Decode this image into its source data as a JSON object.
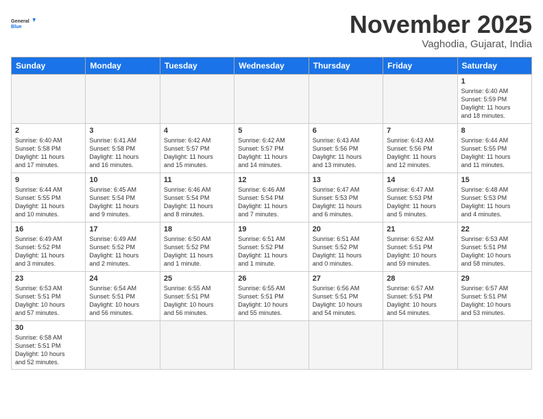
{
  "logo": {
    "general": "General",
    "blue": "Blue"
  },
  "header": {
    "title": "November 2025",
    "subtitle": "Vaghodia, Gujarat, India"
  },
  "weekdays": [
    "Sunday",
    "Monday",
    "Tuesday",
    "Wednesday",
    "Thursday",
    "Friday",
    "Saturday"
  ],
  "weeks": [
    [
      {
        "day": "",
        "info": ""
      },
      {
        "day": "",
        "info": ""
      },
      {
        "day": "",
        "info": ""
      },
      {
        "day": "",
        "info": ""
      },
      {
        "day": "",
        "info": ""
      },
      {
        "day": "",
        "info": ""
      },
      {
        "day": "1",
        "info": "Sunrise: 6:40 AM\nSunset: 5:59 PM\nDaylight: 11 hours\nand 18 minutes."
      }
    ],
    [
      {
        "day": "2",
        "info": "Sunrise: 6:40 AM\nSunset: 5:58 PM\nDaylight: 11 hours\nand 17 minutes."
      },
      {
        "day": "3",
        "info": "Sunrise: 6:41 AM\nSunset: 5:58 PM\nDaylight: 11 hours\nand 16 minutes."
      },
      {
        "day": "4",
        "info": "Sunrise: 6:42 AM\nSunset: 5:57 PM\nDaylight: 11 hours\nand 15 minutes."
      },
      {
        "day": "5",
        "info": "Sunrise: 6:42 AM\nSunset: 5:57 PM\nDaylight: 11 hours\nand 14 minutes."
      },
      {
        "day": "6",
        "info": "Sunrise: 6:43 AM\nSunset: 5:56 PM\nDaylight: 11 hours\nand 13 minutes."
      },
      {
        "day": "7",
        "info": "Sunrise: 6:43 AM\nSunset: 5:56 PM\nDaylight: 11 hours\nand 12 minutes."
      },
      {
        "day": "8",
        "info": "Sunrise: 6:44 AM\nSunset: 5:55 PM\nDaylight: 11 hours\nand 11 minutes."
      }
    ],
    [
      {
        "day": "9",
        "info": "Sunrise: 6:44 AM\nSunset: 5:55 PM\nDaylight: 11 hours\nand 10 minutes."
      },
      {
        "day": "10",
        "info": "Sunrise: 6:45 AM\nSunset: 5:54 PM\nDaylight: 11 hours\nand 9 minutes."
      },
      {
        "day": "11",
        "info": "Sunrise: 6:46 AM\nSunset: 5:54 PM\nDaylight: 11 hours\nand 8 minutes."
      },
      {
        "day": "12",
        "info": "Sunrise: 6:46 AM\nSunset: 5:54 PM\nDaylight: 11 hours\nand 7 minutes."
      },
      {
        "day": "13",
        "info": "Sunrise: 6:47 AM\nSunset: 5:53 PM\nDaylight: 11 hours\nand 6 minutes."
      },
      {
        "day": "14",
        "info": "Sunrise: 6:47 AM\nSunset: 5:53 PM\nDaylight: 11 hours\nand 5 minutes."
      },
      {
        "day": "15",
        "info": "Sunrise: 6:48 AM\nSunset: 5:53 PM\nDaylight: 11 hours\nand 4 minutes."
      }
    ],
    [
      {
        "day": "16",
        "info": "Sunrise: 6:49 AM\nSunset: 5:52 PM\nDaylight: 11 hours\nand 3 minutes."
      },
      {
        "day": "17",
        "info": "Sunrise: 6:49 AM\nSunset: 5:52 PM\nDaylight: 11 hours\nand 2 minutes."
      },
      {
        "day": "18",
        "info": "Sunrise: 6:50 AM\nSunset: 5:52 PM\nDaylight: 11 hours\nand 1 minute."
      },
      {
        "day": "19",
        "info": "Sunrise: 6:51 AM\nSunset: 5:52 PM\nDaylight: 11 hours\nand 1 minute."
      },
      {
        "day": "20",
        "info": "Sunrise: 6:51 AM\nSunset: 5:52 PM\nDaylight: 11 hours\nand 0 minutes."
      },
      {
        "day": "21",
        "info": "Sunrise: 6:52 AM\nSunset: 5:51 PM\nDaylight: 10 hours\nand 59 minutes."
      },
      {
        "day": "22",
        "info": "Sunrise: 6:53 AM\nSunset: 5:51 PM\nDaylight: 10 hours\nand 58 minutes."
      }
    ],
    [
      {
        "day": "23",
        "info": "Sunrise: 6:53 AM\nSunset: 5:51 PM\nDaylight: 10 hours\nand 57 minutes."
      },
      {
        "day": "24",
        "info": "Sunrise: 6:54 AM\nSunset: 5:51 PM\nDaylight: 10 hours\nand 56 minutes."
      },
      {
        "day": "25",
        "info": "Sunrise: 6:55 AM\nSunset: 5:51 PM\nDaylight: 10 hours\nand 56 minutes."
      },
      {
        "day": "26",
        "info": "Sunrise: 6:55 AM\nSunset: 5:51 PM\nDaylight: 10 hours\nand 55 minutes."
      },
      {
        "day": "27",
        "info": "Sunrise: 6:56 AM\nSunset: 5:51 PM\nDaylight: 10 hours\nand 54 minutes."
      },
      {
        "day": "28",
        "info": "Sunrise: 6:57 AM\nSunset: 5:51 PM\nDaylight: 10 hours\nand 54 minutes."
      },
      {
        "day": "29",
        "info": "Sunrise: 6:57 AM\nSunset: 5:51 PM\nDaylight: 10 hours\nand 53 minutes."
      }
    ],
    [
      {
        "day": "30",
        "info": "Sunrise: 6:58 AM\nSunset: 5:51 PM\nDaylight: 10 hours\nand 52 minutes."
      },
      {
        "day": "",
        "info": ""
      },
      {
        "day": "",
        "info": ""
      },
      {
        "day": "",
        "info": ""
      },
      {
        "day": "",
        "info": ""
      },
      {
        "day": "",
        "info": ""
      },
      {
        "day": "",
        "info": ""
      }
    ]
  ]
}
